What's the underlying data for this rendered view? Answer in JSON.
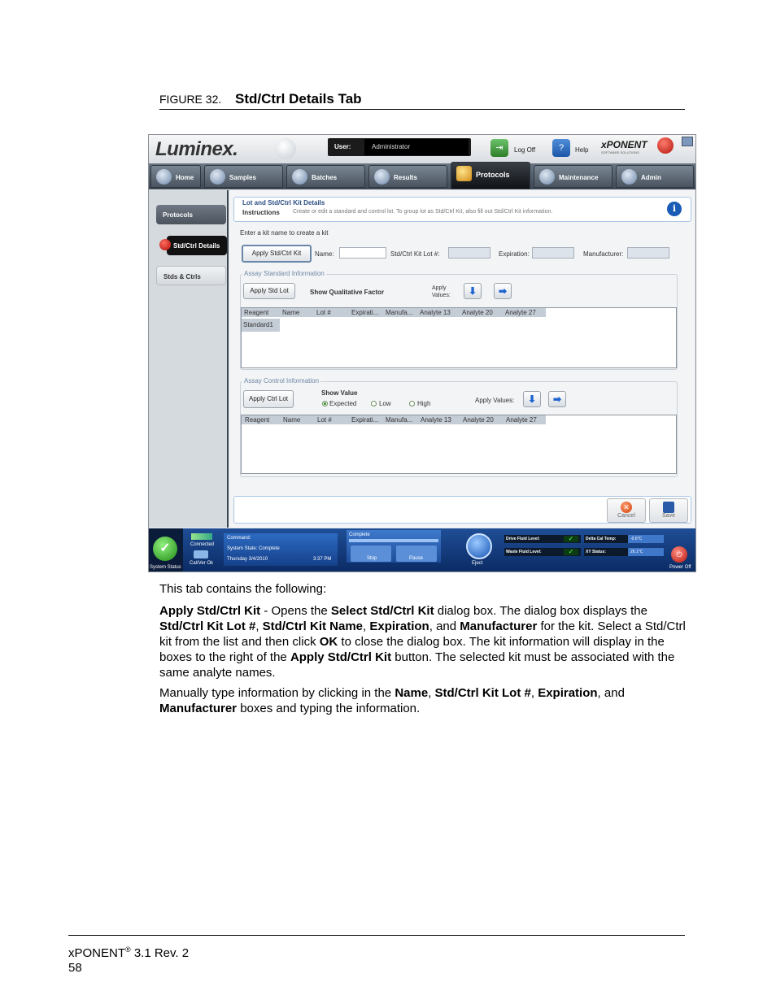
{
  "figure": {
    "number": "FIGURE 32.",
    "title": "Std/Ctrl Details Tab"
  },
  "screenshot": {
    "logo": "Luminex.",
    "user_label": "User:",
    "user_value": "Administrator",
    "logoff_label": "Log Off",
    "help_label": "Help",
    "brand": "xPONENT",
    "brand_sub": "SOFTWARE SOLUTIONS",
    "tabs": [
      {
        "label": "Home"
      },
      {
        "label": "Samples"
      },
      {
        "label": "Batches"
      },
      {
        "label": "Results"
      },
      {
        "label": "Protocols",
        "active": true
      },
      {
        "label": "Maintenance"
      },
      {
        "label": "Admin"
      }
    ],
    "side_items": [
      {
        "label": "Protocols"
      },
      {
        "label": "Std/Ctrl Details"
      },
      {
        "label": "Stds & Ctrls"
      }
    ],
    "details_title": "Lot and Std/Ctrl Kit Details",
    "instructions_label": "Instructions",
    "instructions_text": "Create or edit a standard and control lot.  To group lot as Std/Ctrl Kit, also fill out Std/Ctrl Kit information.",
    "kit_prompt": "Enter a kit name to create a kit",
    "apply_kit_button": "Apply Std/Ctrl Kit",
    "name_label": "Name:",
    "lot_label": "Std/Ctrl Kit Lot #:",
    "expiration_label": "Expiration:",
    "manufacturer_label": "Manufacturer:",
    "assay_standard_label": "Assay Standard Information",
    "apply_std_lot_button": "Apply Std Lot",
    "show_qual_factor": "Show Qualitative Factor",
    "apply_values_label": "Apply Values:",
    "grid_columns": [
      "Reagent",
      "Name",
      "Lot #",
      "Expirati...",
      "Manufa...",
      "Analyte 13",
      "Analyte 20",
      "Analyte 27"
    ],
    "standard_row": "Standard1",
    "assay_control_label": "Assay Control Information",
    "apply_ctrl_lot_button": "Apply Ctrl Lot",
    "show_value_label": "Show Value",
    "radio_options": [
      {
        "label": "Expected",
        "selected": true
      },
      {
        "label": "Low"
      },
      {
        "label": "High"
      }
    ],
    "apply_values_label2": "Apply Values:",
    "cancel_label": "Cancel",
    "save_label": "Save",
    "status_bar": {
      "system_status": "System Status",
      "connected": "Connected",
      "calver": "Cal/Ver Ok",
      "command_label": "Command:",
      "system_state": "System State:  Complete",
      "date": "Thursday 3/4/2010",
      "time": "3:37 PM",
      "progress_label": "Complete",
      "stop": "Stop",
      "pause": "Pause",
      "eject": "Eject",
      "drive_fluid": "Drive Fluid Level:",
      "waste_fluid": "Waste Fluid Level:",
      "delta_cal": "Delta Cal Temp:",
      "delta_cal_value": "-0.6°C",
      "xy_status": "XY Status:",
      "xy_value": "26.1°C",
      "power_off": "Power Off"
    }
  },
  "body": {
    "intro": "This tab contains the following:",
    "p1": [
      {
        "t": "Apply Std/Ctrl Kit",
        "b": true
      },
      {
        "t": " - Opens the "
      },
      {
        "t": "Select Std/Ctrl Kit",
        "b": true
      },
      {
        "t": " dialog box. The dialog box displays the "
      },
      {
        "t": "Std/Ctrl Kit Lot #",
        "b": true
      },
      {
        "t": ", "
      },
      {
        "t": "Std/Ctrl Kit Name",
        "b": true
      },
      {
        "t": ", "
      },
      {
        "t": "Expiration",
        "b": true
      },
      {
        "t": ", and "
      },
      {
        "t": "Manufacturer",
        "b": true
      },
      {
        "t": " for the kit. Select a Std/Ctrl kit from the list and then click "
      },
      {
        "t": "OK",
        "b": true
      },
      {
        "t": " to close the dialog box. The kit information will display in the boxes to the right of the "
      },
      {
        "t": "Apply Std/Ctrl Kit",
        "b": true
      },
      {
        "t": " button. The selected kit must be associated with the same analyte names."
      }
    ],
    "p2": [
      {
        "t": "Manually type information by clicking in the "
      },
      {
        "t": "Name",
        "b": true
      },
      {
        "t": ", "
      },
      {
        "t": "Std/Ctrl Kit Lot #",
        "b": true
      },
      {
        "t": ", "
      },
      {
        "t": "Expiration",
        "b": true
      },
      {
        "t": ", and "
      },
      {
        "t": "Manufacturer",
        "b": true
      },
      {
        "t": " boxes and typing the information."
      }
    ]
  },
  "footer": {
    "product": "xPONENT",
    "reg": "®",
    "version": " 3.1 Rev. 2",
    "page": "58"
  }
}
